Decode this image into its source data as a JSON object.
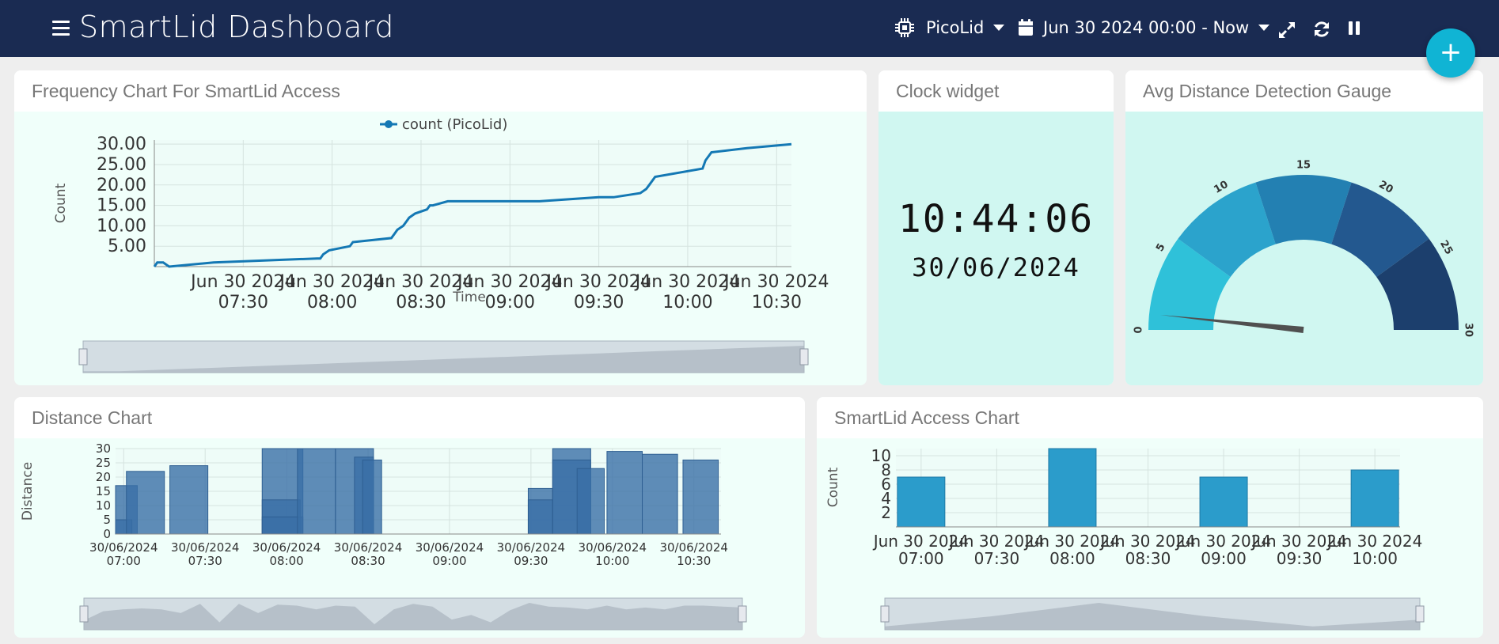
{
  "topbar": {
    "title": "SmartLid Dashboard",
    "device_label": "PicoLid",
    "date_range_label": "Jun 30 2024 00:00 - Now",
    "fab_label": "+"
  },
  "freq_panel": {
    "title": "Frequency Chart For SmartLid Access",
    "chart_data": {
      "type": "line",
      "title": "",
      "xlabel": "Time",
      "ylabel": "Count",
      "x_ticks": [
        [
          "Jun 30 2024",
          "07:30"
        ],
        [
          "Jun 30 2024",
          "08:00"
        ],
        [
          "Jun 30 2024",
          "08:30"
        ],
        [
          "Jun 30 2024",
          "09:00"
        ],
        [
          "Jun 30 2024",
          "09:30"
        ],
        [
          "Jun 30 2024",
          "10:00"
        ],
        [
          "Jun 30 2024",
          "10:30"
        ]
      ],
      "y_ticks": [
        "5.00",
        "10.00",
        "15.00",
        "20.00",
        "25.00",
        "30.00"
      ],
      "xlim": [
        "07:00",
        "10:35"
      ],
      "ylim": [
        0,
        31
      ],
      "legend": "top-center",
      "series": [
        {
          "name": "count (PicoLid)",
          "color": "#1478b4",
          "x": [
            "07:00",
            "07:01",
            "07:03",
            "07:05",
            "07:20",
            "07:55",
            "07:56",
            "07:57",
            "07:59",
            "08:06",
            "08:07",
            "08:20",
            "08:21",
            "08:22",
            "08:24",
            "08:25",
            "08:26",
            "08:28",
            "08:32",
            "08:33",
            "08:34",
            "08:39",
            "08:40",
            "08:50",
            "09:10",
            "09:30",
            "09:35",
            "09:44",
            "09:46",
            "09:47",
            "09:49",
            "10:05",
            "10:06",
            "10:08",
            "10:20",
            "10:35"
          ],
          "y": [
            0,
            1,
            1,
            0,
            1,
            2,
            2,
            3,
            4,
            5,
            6,
            7,
            8,
            9,
            10,
            11,
            12,
            13,
            14,
            15,
            15,
            16,
            16,
            16,
            16,
            17,
            17,
            18,
            19,
            20,
            22,
            24,
            26,
            28,
            29,
            30
          ]
        }
      ],
      "navigator": {
        "type": "area",
        "values": [
          1,
          1,
          2,
          3,
          4,
          5,
          6,
          7,
          8,
          9,
          10,
          11,
          12,
          13,
          14,
          15,
          16,
          17,
          18,
          19,
          20
        ]
      }
    }
  },
  "clock_panel": {
    "title": "Clock widget",
    "time": "10:44:06",
    "date": "30/06/2024"
  },
  "gauge_panel": {
    "title": "Avg Distance Detection Gauge",
    "chart_data": {
      "type": "gauge",
      "min": 0,
      "max": 30,
      "value": 1,
      "tick_labels": [
        "0",
        "5",
        "10",
        "15",
        "20",
        "25",
        "30"
      ],
      "bands": [
        {
          "from": 0,
          "to": 6,
          "color": "#2fc1d9"
        },
        {
          "from": 6,
          "to": 12,
          "color": "#2ba3cc"
        },
        {
          "from": 12,
          "to": 18,
          "color": "#2380b2"
        },
        {
          "from": 18,
          "to": 24,
          "color": "#23588f"
        },
        {
          "from": 24,
          "to": 30,
          "color": "#1c3f6d"
        }
      ]
    }
  },
  "distance_panel": {
    "title": "Distance Chart",
    "chart_data": {
      "type": "bar",
      "ylabel": "Distance",
      "xlabel": "",
      "ylim": [
        0,
        30
      ],
      "y_ticks": [
        "0",
        "5",
        "10",
        "15",
        "20",
        "25",
        "30"
      ],
      "x_ticks": [
        [
          "30/06/2024",
          "07:00"
        ],
        [
          "30/06/2024",
          "07:30"
        ],
        [
          "30/06/2024",
          "08:00"
        ],
        [
          "30/06/2024",
          "08:30"
        ],
        [
          "30/06/2024",
          "09:00"
        ],
        [
          "30/06/2024",
          "09:30"
        ],
        [
          "30/06/2024",
          "10:00"
        ],
        [
          "30/06/2024",
          "10:30"
        ]
      ],
      "xlim": [
        "06:57",
        "10:40"
      ],
      "bar_color": "#3a6fa6",
      "bars": [
        {
          "start": "06:57",
          "end": "07:05",
          "value": 17
        },
        {
          "start": "06:57",
          "end": "07:03",
          "value": 5
        },
        {
          "start": "07:01",
          "end": "07:15",
          "value": 22
        },
        {
          "start": "07:17",
          "end": "07:31",
          "value": 24
        },
        {
          "start": "07:51",
          "end": "08:06",
          "value": 30
        },
        {
          "start": "07:51",
          "end": "08:05",
          "value": 12
        },
        {
          "start": "07:51",
          "end": "08:06",
          "value": 6
        },
        {
          "start": "08:04",
          "end": "08:18",
          "value": 30
        },
        {
          "start": "08:18",
          "end": "08:32",
          "value": 30
        },
        {
          "start": "08:25",
          "end": "08:32",
          "value": 27
        },
        {
          "start": "08:28",
          "end": "08:35",
          "value": 26
        },
        {
          "start": "09:29",
          "end": "09:38",
          "value": 16
        },
        {
          "start": "09:29",
          "end": "09:38",
          "value": 12
        },
        {
          "start": "09:38",
          "end": "09:52",
          "value": 30
        },
        {
          "start": "09:38",
          "end": "09:52",
          "value": 26
        },
        {
          "start": "09:47",
          "end": "09:57",
          "value": 23
        },
        {
          "start": "09:58",
          "end": "10:11",
          "value": 29
        },
        {
          "start": "10:11",
          "end": "10:24",
          "value": 28
        },
        {
          "start": "10:26",
          "end": "10:39",
          "value": 26
        }
      ],
      "navigator": {
        "type": "area",
        "values": [
          10,
          20,
          22,
          23,
          22,
          18,
          28,
          8,
          28,
          18,
          27,
          26,
          22,
          26,
          25,
          6,
          22,
          28,
          25,
          11,
          16,
          8,
          21,
          29,
          25,
          24,
          22,
          26,
          22,
          24,
          22,
          26,
          26,
          25,
          24
        ]
      }
    }
  },
  "access_panel": {
    "title": "SmartLid Access Chart",
    "chart_data": {
      "type": "bar",
      "ylabel": "Count",
      "xlabel": "",
      "ylim": [
        0,
        11
      ],
      "y_ticks": [
        "2",
        "4",
        "6",
        "8",
        "10"
      ],
      "x_ticks": [
        [
          "Jun 30 2024",
          "07:00"
        ],
        [
          "Jun 30 2024",
          "07:30"
        ],
        [
          "Jun 30 2024",
          "08:00"
        ],
        [
          "Jun 30 2024",
          "08:30"
        ],
        [
          "Jun 30 2024",
          "09:00"
        ],
        [
          "Jun 30 2024",
          "09:30"
        ],
        [
          "Jun 30 2024",
          "10:00"
        ]
      ],
      "xlim": [
        "06:50",
        "10:10"
      ],
      "bar_color": "#2b9ccb",
      "bars": [
        {
          "center": "07:00",
          "value": 7
        },
        {
          "center": "08:00",
          "value": 11
        },
        {
          "center": "09:00",
          "value": 7
        },
        {
          "center": "10:00",
          "value": 8
        }
      ],
      "navigator": {
        "type": "area",
        "values": [
          1,
          4,
          8,
          4,
          1,
          3
        ]
      }
    }
  }
}
